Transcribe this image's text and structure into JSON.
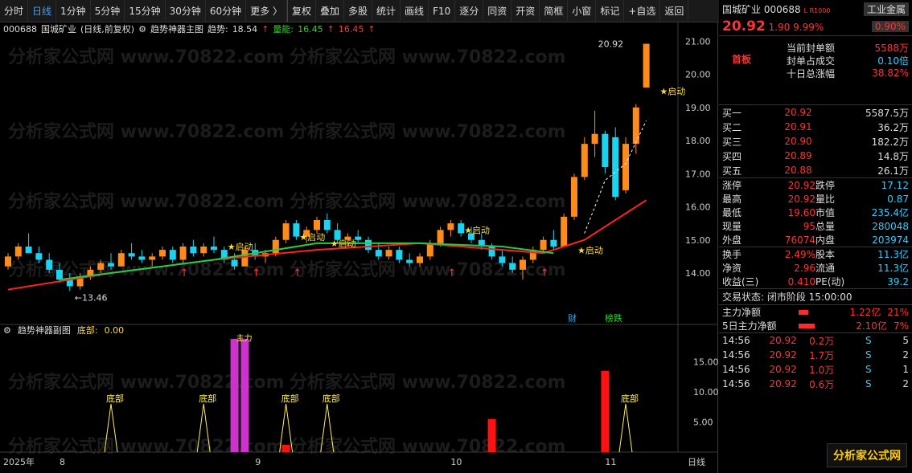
{
  "toolbar": {
    "items": [
      "分时",
      "日线",
      "1分钟",
      "5分钟",
      "15分钟",
      "30分钟",
      "60分钟",
      "更多 〉",
      "复权",
      "叠加",
      "多股",
      "统计",
      "画线",
      "F10",
      "逐分",
      "同资",
      "开资",
      "简框",
      "小窗",
      "标记",
      "+自选",
      "返回"
    ],
    "active_index": 1
  },
  "main": {
    "code": "000688",
    "name": "国城矿业",
    "period": "(日线,前复权)",
    "indicator_title": "趋势神器主图",
    "trend_label": "趋势:",
    "trend_value": "18.54",
    "energy_label": "量能:",
    "energy_value": "16.45",
    "extra_value": "16.45",
    "max_label": "20.92",
    "min_label": "13.46",
    "start_label": "启动",
    "mark_cai": "财",
    "mark_bang": "榜跌",
    "sub_title": "趋势神器副图",
    "sub_label": "底部:",
    "sub_value": "0.00",
    "bottom_label": "底部",
    "zhuli_label": "主力",
    "price_axis": [
      "21.00",
      "20.00",
      "19.00",
      "18.00",
      "17.00",
      "16.00",
      "15.00",
      "14.00"
    ],
    "sub_axis": [
      "15.00",
      "10.00",
      "5.00"
    ],
    "date_axis": [
      "2025年",
      "8",
      "9",
      "10",
      "11"
    ],
    "period_tab": "日线",
    "watermark": "分析家公式网 www.70822.com"
  },
  "chart_data": {
    "type": "candlestick",
    "title": "国城矿业 (日线,前复权)",
    "ylim": [
      13.2,
      21.2
    ],
    "candles": [
      [
        14.2,
        14.6,
        14.1,
        14.5
      ],
      [
        14.5,
        14.9,
        14.4,
        14.8
      ],
      [
        14.8,
        15.2,
        14.6,
        14.6
      ],
      [
        14.6,
        14.8,
        14.3,
        14.4
      ],
      [
        14.4,
        14.6,
        14.0,
        14.1
      ],
      [
        14.1,
        14.3,
        13.7,
        13.8
      ],
      [
        13.8,
        14.0,
        13.46,
        13.6
      ],
      [
        13.6,
        14.0,
        13.5,
        13.9
      ],
      [
        13.9,
        14.2,
        13.8,
        14.1
      ],
      [
        14.1,
        14.4,
        14.0,
        14.3
      ],
      [
        14.3,
        14.6,
        14.1,
        14.2
      ],
      [
        14.2,
        14.7,
        14.2,
        14.6
      ],
      [
        14.6,
        14.9,
        14.4,
        14.5
      ],
      [
        14.5,
        14.7,
        14.3,
        14.4
      ],
      [
        14.4,
        14.6,
        14.2,
        14.5
      ],
      [
        14.5,
        14.8,
        14.4,
        14.7
      ],
      [
        14.7,
        14.8,
        14.3,
        14.4
      ],
      [
        14.4,
        14.9,
        14.3,
        14.8
      ],
      [
        14.8,
        15.0,
        14.5,
        14.6
      ],
      [
        14.6,
        14.9,
        14.5,
        14.8
      ],
      [
        14.8,
        15.1,
        14.6,
        14.7
      ],
      [
        14.7,
        14.8,
        14.3,
        14.4
      ],
      [
        14.4,
        14.6,
        14.1,
        14.2
      ],
      [
        14.2,
        14.8,
        14.2,
        14.7
      ],
      [
        14.7,
        14.9,
        14.4,
        14.5
      ],
      [
        14.5,
        14.7,
        14.3,
        14.6
      ],
      [
        14.6,
        15.1,
        14.5,
        15.0
      ],
      [
        15.0,
        15.6,
        14.9,
        15.5
      ],
      [
        15.5,
        15.6,
        15.0,
        15.1
      ],
      [
        15.1,
        15.4,
        14.9,
        15.3
      ],
      [
        15.3,
        15.7,
        15.2,
        15.6
      ],
      [
        15.6,
        15.8,
        15.2,
        15.3
      ],
      [
        15.3,
        15.5,
        14.9,
        15.0
      ],
      [
        15.0,
        15.2,
        14.8,
        15.1
      ],
      [
        15.1,
        15.3,
        14.9,
        15.0
      ],
      [
        15.0,
        15.1,
        14.6,
        14.7
      ],
      [
        14.7,
        14.9,
        14.4,
        14.5
      ],
      [
        14.5,
        14.8,
        14.4,
        14.7
      ],
      [
        14.7,
        14.8,
        14.3,
        14.4
      ],
      [
        14.4,
        14.6,
        14.2,
        14.3
      ],
      [
        14.3,
        14.6,
        14.2,
        14.5
      ],
      [
        14.5,
        15.0,
        14.4,
        14.9
      ],
      [
        14.9,
        15.4,
        14.8,
        15.3
      ],
      [
        15.3,
        15.6,
        15.1,
        15.5
      ],
      [
        15.5,
        15.6,
        15.1,
        15.2
      ],
      [
        15.2,
        15.4,
        14.9,
        15.0
      ],
      [
        15.0,
        15.2,
        14.7,
        14.8
      ],
      [
        14.8,
        14.9,
        14.4,
        14.5
      ],
      [
        14.5,
        14.7,
        14.2,
        14.3
      ],
      [
        14.3,
        14.5,
        14.0,
        14.1
      ],
      [
        14.1,
        14.5,
        13.8,
        14.4
      ],
      [
        14.4,
        14.8,
        14.3,
        14.7
      ],
      [
        14.7,
        15.1,
        14.6,
        15.0
      ],
      [
        15.0,
        15.3,
        14.7,
        14.8
      ],
      [
        14.8,
        15.8,
        14.8,
        15.7
      ],
      [
        15.7,
        17.0,
        15.6,
        16.9
      ],
      [
        16.9,
        18.1,
        16.8,
        17.9
      ],
      [
        17.9,
        18.9,
        17.5,
        18.2
      ],
      [
        18.2,
        18.3,
        17.0,
        17.2
      ],
      [
        18.1,
        18.4,
        16.2,
        16.3
      ],
      [
        16.5,
        18.1,
        16.4,
        17.9
      ],
      [
        17.9,
        19.1,
        17.6,
        19.0
      ],
      [
        19.6,
        20.92,
        19.6,
        20.92
      ]
    ],
    "ma_green": [
      [
        5,
        13.8
      ],
      [
        10,
        14.0
      ],
      [
        20,
        14.4
      ],
      [
        30,
        14.9
      ],
      [
        40,
        14.9
      ],
      [
        48,
        14.8
      ],
      [
        53,
        14.6
      ]
    ],
    "ma_red": [
      [
        0,
        13.5
      ],
      [
        10,
        14.0
      ],
      [
        20,
        14.4
      ],
      [
        30,
        14.7
      ],
      [
        40,
        14.9
      ],
      [
        48,
        14.7
      ],
      [
        52,
        14.6
      ],
      [
        56,
        15.0
      ],
      [
        60,
        15.8
      ],
      [
        62,
        16.2
      ]
    ],
    "sub_bars": [
      {
        "i": 22,
        "h": 18.8,
        "c": "#cc33cc"
      },
      {
        "i": 23,
        "h": 18.8,
        "c": "#cc33cc"
      },
      {
        "i": 27,
        "h": 1.2,
        "c": "#ff1111"
      },
      {
        "i": 47,
        "h": 5.5,
        "c": "#ff1111"
      },
      {
        "i": 58,
        "h": 13.5,
        "c": "#ff1111"
      }
    ],
    "sub_peaks": [
      10,
      19,
      27,
      31,
      60
    ],
    "sub_ylim": [
      0,
      18
    ]
  },
  "sidebar": {
    "name": "国城矿业",
    "code": "000688",
    "badge": "L R1000",
    "sector": "工业金属",
    "sector_change": "0.90%",
    "price": "20.92",
    "change": "1.90",
    "pct": "9.99%",
    "first_board": "首板",
    "info": [
      [
        "当前封单额",
        "5588万"
      ],
      [
        "封单占成交",
        "0.10倍"
      ],
      [
        "十日总涨幅",
        "38.82%"
      ]
    ],
    "asks": [
      [
        "买一",
        "20.92",
        "5587.5万"
      ],
      [
        "买二",
        "20.91",
        "36.2万"
      ],
      [
        "买三",
        "20.90",
        "182.2万"
      ],
      [
        "买四",
        "20.89",
        "14.8万"
      ],
      [
        "买五",
        "20.88",
        "26.1万"
      ]
    ],
    "stats": [
      [
        "涨停",
        "20.92",
        "跌停",
        "17.12"
      ],
      [
        "最高",
        "20.92",
        "量比",
        "0.87"
      ],
      [
        "最低",
        "19.60",
        "市值",
        "235.4亿"
      ],
      [
        "现量",
        "95",
        "总量",
        "280048"
      ],
      [
        "外盘",
        "76074",
        "内盘",
        "203974"
      ]
    ],
    "stats2": [
      [
        "换手",
        "2.49%",
        "股本",
        "11.3亿"
      ],
      [
        "净资",
        "2.96",
        "流通",
        "11.3亿"
      ],
      [
        "收益(三)",
        "0.410",
        "PE(动)",
        "39.2"
      ]
    ],
    "trade_status": "交易状态: 闭市阶段 15:00:00",
    "flows": [
      [
        "主力净额",
        "1.22亿",
        "21%"
      ],
      [
        "5日主力净额",
        "2.10亿",
        "7%"
      ]
    ],
    "ticks": [
      [
        "14:56",
        "20.92",
        "0.2万",
        "S",
        "5"
      ],
      [
        "14:56",
        "20.92",
        "1.7万",
        "S",
        "2"
      ],
      [
        "14:56",
        "20.92",
        "1.0万",
        "S",
        "1"
      ],
      [
        "14:56",
        "20.92",
        "0.6万",
        "S",
        "2"
      ]
    ],
    "logo_text": "分析家公式网",
    "logo_url": "www.70822.com"
  }
}
